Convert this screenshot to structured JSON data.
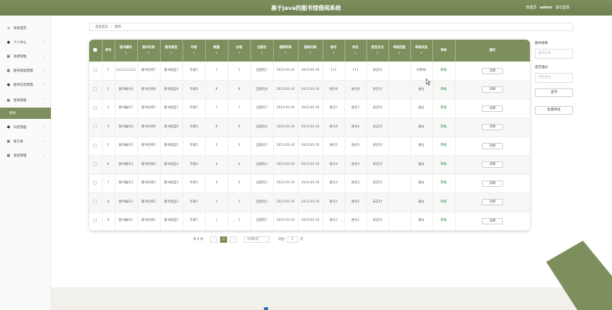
{
  "header": {
    "title": "基于java的图书馆借阅系统",
    "role": "管理员",
    "username": "admin",
    "logout": "退出登录"
  },
  "sidebar": {
    "items": [
      {
        "label": "系统首页",
        "icon": "home-icon"
      },
      {
        "label": "个人中心",
        "icon": "user-icon"
      },
      {
        "label": "读者管理",
        "icon": "grid-icon"
      },
      {
        "label": "图书类型管理",
        "icon": "grid-icon"
      },
      {
        "label": "图书信息管理",
        "icon": "user-icon"
      },
      {
        "label": "借阅管理",
        "icon": "grid-icon"
      },
      {
        "label": "归还管理",
        "icon": "shield-icon"
      },
      {
        "label": "留言板",
        "icon": "grid-icon"
      },
      {
        "label": "系统管理",
        "icon": "grid-icon"
      }
    ],
    "active_sub": "借阅"
  },
  "breadcrumb": {
    "home": "后台首页",
    "sep": "/",
    "current": "借阅"
  },
  "table": {
    "headers": [
      {
        "label": "",
        "sortable": false
      },
      {
        "label": "序号",
        "sortable": false
      },
      {
        "label": "图书编号",
        "sortable": true
      },
      {
        "label": "图书名称",
        "sortable": true
      },
      {
        "label": "图书类型",
        "sortable": true
      },
      {
        "label": "作者",
        "sortable": true
      },
      {
        "label": "数量",
        "sortable": true
      },
      {
        "label": "价格",
        "sortable": true
      },
      {
        "label": "出版社",
        "sortable": true
      },
      {
        "label": "借阅时间",
        "sortable": true
      },
      {
        "label": "借阅日期",
        "sortable": true
      },
      {
        "label": "账号",
        "sortable": true
      },
      {
        "label": "姓名",
        "sortable": true
      },
      {
        "label": "是否支付",
        "sortable": true
      },
      {
        "label": "审核回复",
        "sortable": true
      },
      {
        "label": "审核状态",
        "sortable": true
      },
      {
        "label": "审核",
        "sortable": false
      },
      {
        "label": "操作",
        "sortable": false
      }
    ],
    "sort_icon": "⇕",
    "audit_label": "审核",
    "detail_label": "详情",
    "rows": [
      [
        "1",
        "1111111111",
        "图书名称7",
        "图书类型7",
        "作者1",
        "1",
        "1",
        "出版社1",
        "2023-05-16",
        "2023-05-16",
        "111",
        "111",
        "未支付",
        "",
        "待审核"
      ],
      [
        "2",
        "图书编号8",
        "图书名称8",
        "图书类型8",
        "作者8",
        "8",
        "8",
        "出版社8",
        "2023-05-16",
        "2023-05-16",
        "账号8",
        "姓名8",
        "未支付",
        "",
        "通过"
      ],
      [
        "3",
        "图书编号7",
        "图书名称7",
        "图书类型7",
        "作者7",
        "7",
        "7",
        "出版社7",
        "2023-05-16",
        "2023-05-16",
        "账号7",
        "姓名7",
        "未支付",
        "",
        "通过"
      ],
      [
        "4",
        "图书编号6",
        "图书名称6",
        "图书类型6",
        "作者6",
        "6",
        "6",
        "出版社6",
        "2023-05-16",
        "2023-05-16",
        "账号6",
        "姓名6",
        "未支付",
        "",
        "通过"
      ],
      [
        "5",
        "图书编号5",
        "图书名称5",
        "图书类型5",
        "作者5",
        "5",
        "5",
        "出版社5",
        "2023-05-16",
        "2023-05-16",
        "账号5",
        "姓名5",
        "未支付",
        "",
        "通过"
      ],
      [
        "6",
        "图书编号4",
        "图书名称4",
        "图书类型4",
        "作者4",
        "4",
        "4",
        "出版社4",
        "2023-05-16",
        "2023-05-16",
        "账号4",
        "姓名4",
        "未支付",
        "",
        "通过"
      ],
      [
        "7",
        "图书编号3",
        "图书名称3",
        "图书类型3",
        "作者3",
        "3",
        "3",
        "出版社3",
        "2023-05-16",
        "2023-05-16",
        "账号3",
        "姓名3",
        "未支付",
        "",
        "通过"
      ],
      [
        "8",
        "图书编号2",
        "图书名称2",
        "图书类型2",
        "作者2",
        "2",
        "2",
        "出版社2",
        "2023-05-16",
        "2023-05-16",
        "账号2",
        "姓名2",
        "未支付",
        "",
        "通过"
      ],
      [
        "9",
        "图书编号1",
        "图书名称1",
        "图书类型1",
        "作者1",
        "1",
        "1",
        "出版社1",
        "2023-05-16",
        "2023-05-16",
        "账号1",
        "姓名1",
        "未支付",
        "",
        "通过"
      ]
    ]
  },
  "pagination": {
    "total": "共 9 条",
    "prev": "‹",
    "current_page": "1",
    "next": "›",
    "page_size": "10条/页",
    "goto_prefix": "前往",
    "goto_value": "1",
    "goto_suffix": "页"
  },
  "search": {
    "name_label": "图书名称",
    "name_placeholder": "图书名称",
    "pass_label": "是否通过",
    "pass_placeholder": "是否通过",
    "query_button": "查询",
    "batch_button": "批量审核"
  },
  "colors": {
    "accent": "#7d8f5c",
    "audit_link": "#2e8b3e"
  }
}
